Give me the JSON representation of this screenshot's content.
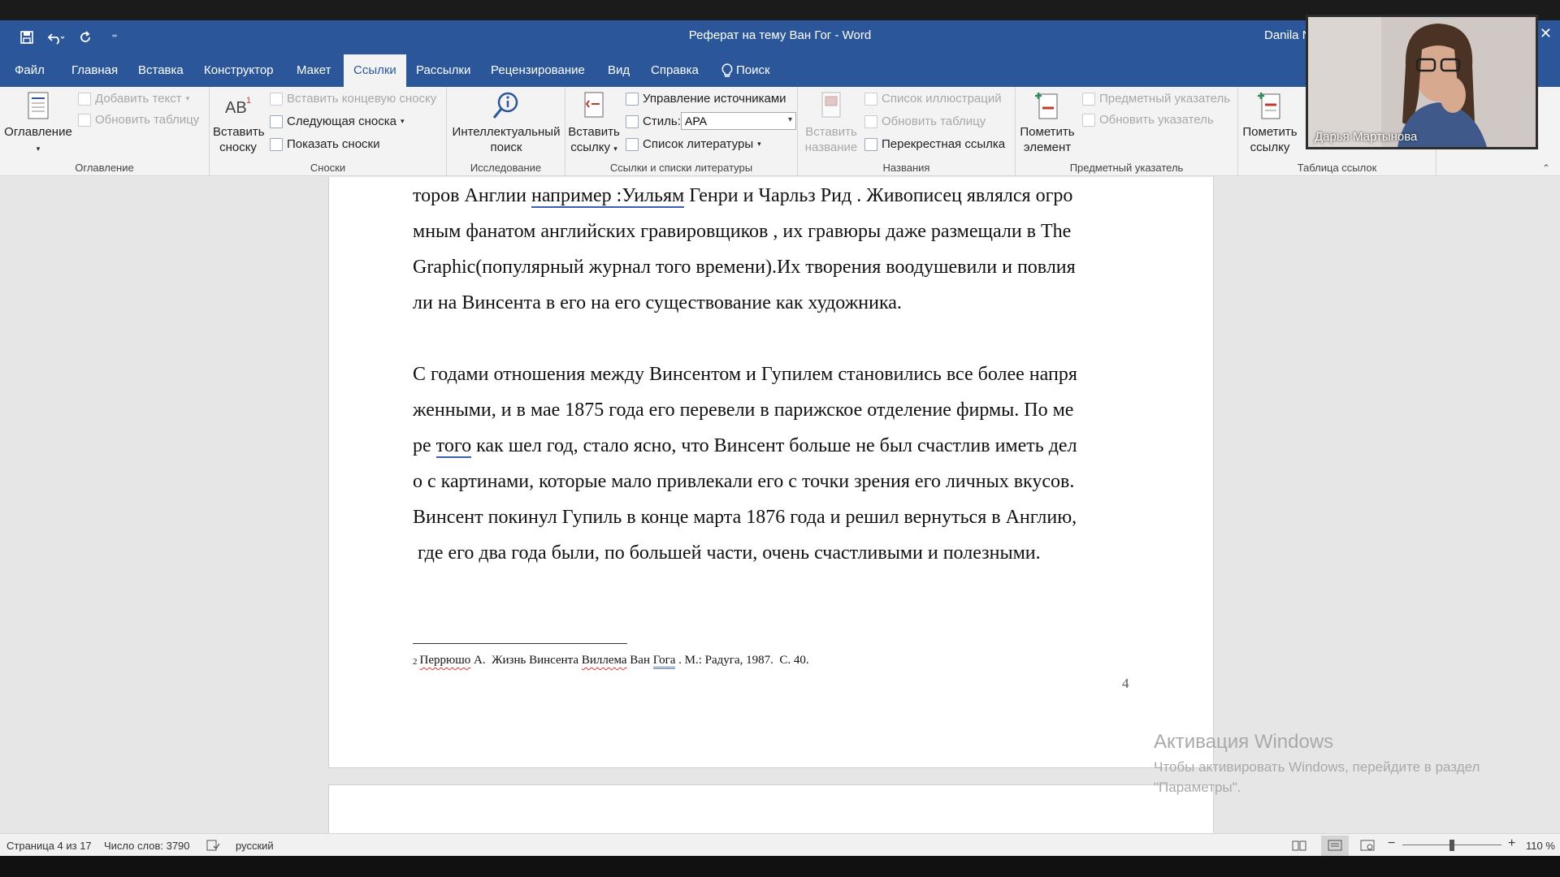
{
  "window": {
    "title": "Реферат на тему Ван Гог  -  Word",
    "user_truncated": "Danila N",
    "minimize": "—",
    "restore": "❐",
    "close": "✕"
  },
  "qat": {
    "icons": [
      "save-icon",
      "undo-icon",
      "redo-icon",
      "customize-icon"
    ],
    "customize": "⁼"
  },
  "tabs": [
    {
      "label": "Файл",
      "active": false
    },
    {
      "label": "Главная",
      "active": false
    },
    {
      "label": "Вставка",
      "active": false
    },
    {
      "label": "Конструктор",
      "active": false
    },
    {
      "label": "Макет",
      "active": false
    },
    {
      "label": "Ссылки",
      "active": true
    },
    {
      "label": "Рассылки",
      "active": false
    },
    {
      "label": "Рецензирование",
      "active": false
    },
    {
      "label": "Вид",
      "active": false
    },
    {
      "label": "Справка",
      "active": false
    },
    {
      "label": "Поиск",
      "active": false
    }
  ],
  "ribbon": {
    "toc": {
      "big": "Оглавление",
      "add_text": "Добавить текст",
      "update_table": "Обновить таблицу",
      "label": "Оглавление"
    },
    "footnotes": {
      "insert_big_1": "Вставить",
      "insert_big_2": "сноску",
      "insert_endnote": "Вставить концевую сноску",
      "next_footnote": "Следующая сноска",
      "show_notes": "Показать сноски",
      "label": "Сноски"
    },
    "research": {
      "big_1": "Интеллектуальный",
      "big_2": "поиск",
      "label": "Исследование"
    },
    "citations": {
      "insert_1": "Вставить",
      "insert_2": "ссылку",
      "manage_sources": "Управление источниками",
      "style_label": "Стиль:",
      "style_value": "APA",
      "bibliography": "Список литературы",
      "label": "Ссылки и списки литературы"
    },
    "captions": {
      "insert_1": "Вставить",
      "insert_2": "название",
      "list_illustrations": "Список иллюстраций",
      "update_table": "Обновить таблицу",
      "cross_reference": "Перекрестная ссылка",
      "label": "Названия"
    },
    "index": {
      "mark_1": "Пометить",
      "mark_2": "элемент",
      "subject_index": "Предметный указатель",
      "update_index": "Обновить указатель",
      "label": "Предметный указатель"
    },
    "authorities": {
      "mark_1": "Пометить",
      "mark_2": "ссылку",
      "label": "Таблица ссылок"
    }
  },
  "document": {
    "lines": [
      {
        "pre": "торов Англии ",
        "link": "например :Уильям",
        "post": " Генри и Чарльз Рид . Живописец являлся огро"
      },
      {
        "text": "мным фанатом английских гравировщиков , их гравюры даже размещали в The"
      },
      {
        "text": "Graphic(популярный журнал того времени).Их творения воодушевили и повлия"
      },
      {
        "text": "ли на Винсента в его на его существование как художника."
      },
      {
        "text": "С годами отношения между Винсентом и Гупилем становились все более напря"
      },
      {
        "text": "женными, и в мае 1875 года его перевели в парижское отделение фирмы. По ме"
      },
      {
        "pre": "ре ",
        "link": "того",
        "post": " как шел год, стало ясно, что Винсент больше не был счастлив иметь дел"
      },
      {
        "text": "о с картинами, которые мало привлекали его с точки зрения его личных вкусов."
      },
      {
        "text": "Винсент покинул Гупиль в конце марта 1876 года и решил вернуться в Англию,"
      },
      {
        "text": " где его два года были, по большей части, очень счастливыми и полезными."
      }
    ],
    "footnote": {
      "num": "2",
      "author": "Перрюшо",
      "a1": " А.  Жизнь Винсента ",
      "name": "Виллема",
      "a2": " Ван ",
      "gog": "Гога",
      "rest": " . М.: Радуга, 1987.  С. 40."
    },
    "page_number": "4"
  },
  "activation": {
    "title": "Активация Windows",
    "text_1": "Чтобы активировать Windows, перейдите в раздел",
    "text_2": "\"Параметры\"."
  },
  "status": {
    "page": "Страница 4 из 17",
    "words": "Число слов: 3790",
    "language": "русский",
    "zoom": "110 %",
    "zoom_minus": "−",
    "zoom_plus": "+"
  },
  "webcam": {
    "name": "Дарья Мартынова"
  },
  "colors": {
    "accent": "#2b579a",
    "ribbon": "#f3f3f3",
    "page_bg": "#e6e6e6"
  }
}
